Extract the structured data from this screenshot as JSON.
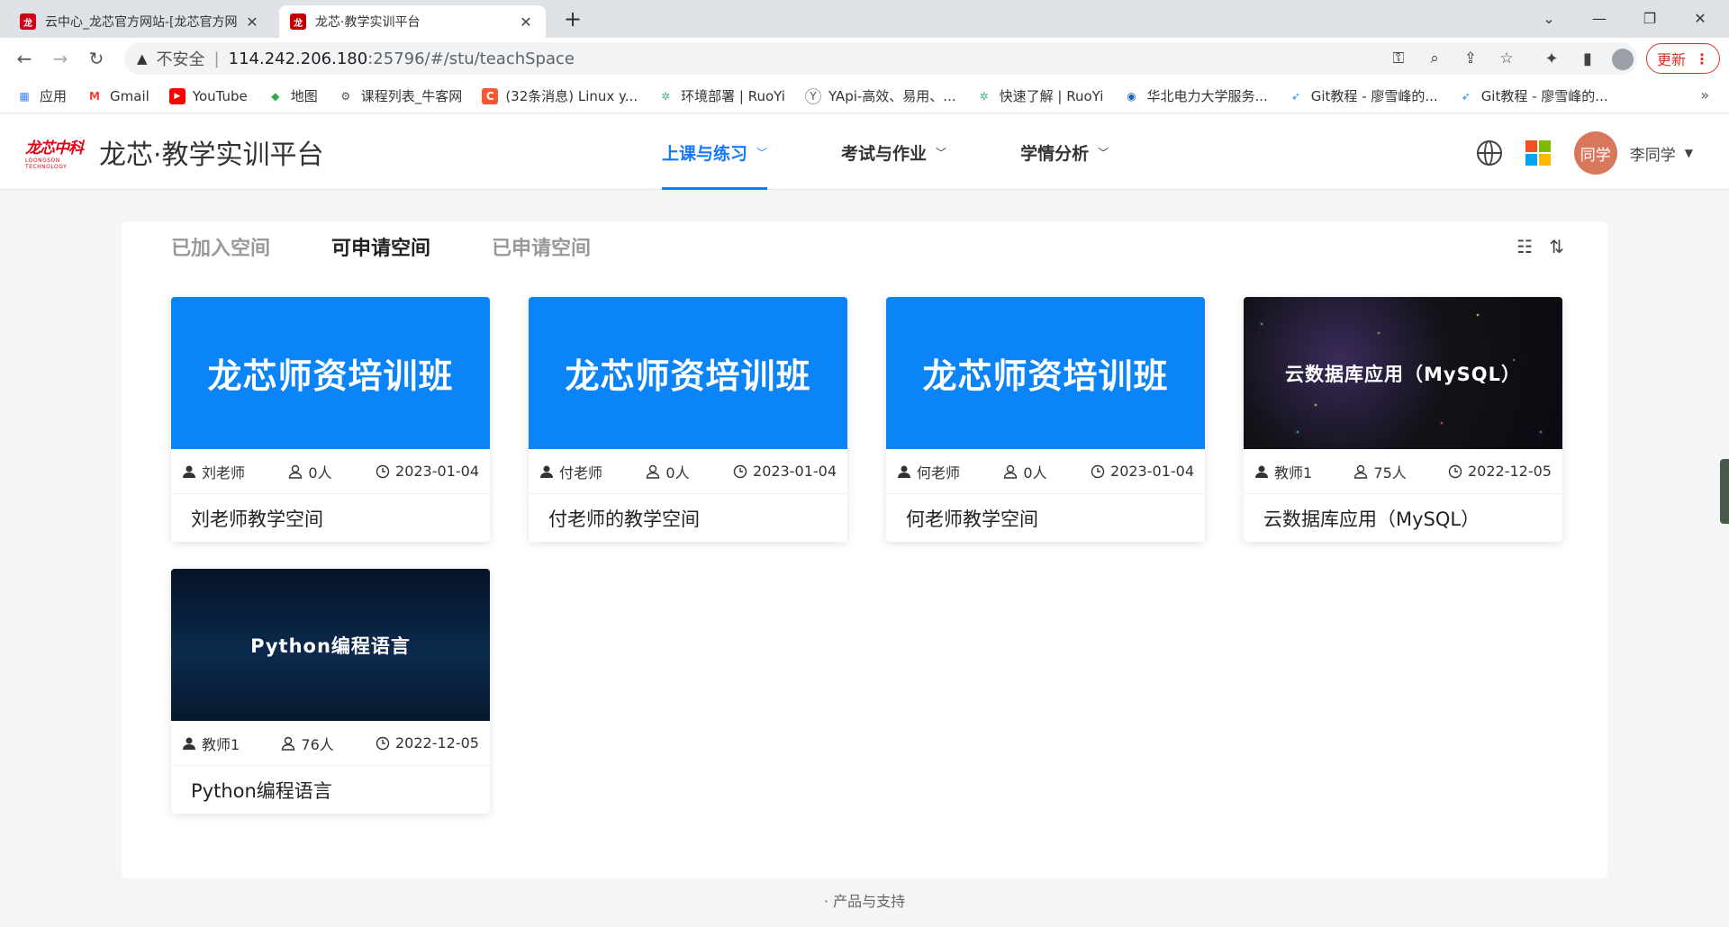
{
  "browser": {
    "tabs": [
      {
        "title": "云中心_龙芯官方网站-[龙芯官方网",
        "favicon_text": "龙",
        "favicon_color": "#d0021b"
      },
      {
        "title": "龙芯·教学实训平台",
        "favicon_text": "龙",
        "favicon_color": "#c00000"
      }
    ],
    "address": {
      "insecure_label": "不安全",
      "host": "114.242.206.180",
      "path": ":25796/#/stu/teachSpace"
    },
    "update_label": "更新",
    "bookmarks": [
      {
        "label": "应用",
        "icon": "apps-grid-icon"
      },
      {
        "label": "Gmail",
        "icon": "gmail-icon"
      },
      {
        "label": "YouTube",
        "icon": "youtube-icon"
      },
      {
        "label": "地图",
        "icon": "maps-icon"
      },
      {
        "label": "课程列表_牛客网",
        "icon": "nowcoder-icon"
      },
      {
        "label": "(32条消息) Linux y...",
        "icon": "csdn-icon"
      },
      {
        "label": "环境部署 | RuoYi",
        "icon": "ruoyi-icon"
      },
      {
        "label": "YApi-高效、易用、...",
        "icon": "yapi-icon"
      },
      {
        "label": "快速了解 | RuoYi",
        "icon": "ruoyi-icon"
      },
      {
        "label": "华北电力大学服务...",
        "icon": "ncepu-icon"
      },
      {
        "label": "Git教程 - 廖雪峰的...",
        "icon": "rocket-icon"
      },
      {
        "label": "Git教程 - 廖雪峰的...",
        "icon": "rocket-icon"
      }
    ]
  },
  "header": {
    "brand_logo_cn": "龙芯中科",
    "brand_logo_en": "LOONGSON TECHNOLOGY",
    "title": "龙芯·教学实训平台",
    "nav": [
      {
        "label": "上课与练习",
        "active": true
      },
      {
        "label": "考试与作业",
        "active": false
      },
      {
        "label": "学情分析",
        "active": false
      }
    ],
    "avatar_text": "同学",
    "user_name": "李同学"
  },
  "space_tabs": [
    {
      "label": "已加入空间",
      "active": false
    },
    {
      "label": "可申请空间",
      "active": true
    },
    {
      "label": "已申请空间",
      "active": false
    }
  ],
  "courses": [
    {
      "cover_text": "龙芯师资培训班",
      "cover_style": "blue",
      "teacher": "刘老师",
      "members": "0人",
      "date": "2023-01-04",
      "title": "刘老师教学空间"
    },
    {
      "cover_text": "龙芯师资培训班",
      "cover_style": "blue",
      "teacher": "付老师",
      "members": "0人",
      "date": "2023-01-04",
      "title": "付老师的教学空间"
    },
    {
      "cover_text": "龙芯师资培训班",
      "cover_style": "blue",
      "teacher": "何老师",
      "members": "0人",
      "date": "2023-01-04",
      "title": "何老师教学空间"
    },
    {
      "cover_text": "云数据库应用（MySQL）",
      "cover_style": "dark",
      "teacher": "教师1",
      "members": "75人",
      "date": "2022-12-05",
      "title": "云数据库应用（MySQL）"
    },
    {
      "cover_text": "Python编程语言",
      "cover_style": "navy",
      "teacher": "教师1",
      "members": "76人",
      "date": "2022-12-05",
      "title": "Python编程语言"
    }
  ],
  "footer": {
    "text": "· 产品与支持"
  },
  "colors": {
    "accent": "#1677ff",
    "avatar": "#d9775c",
    "cover_blue": "#0a84f7",
    "update": "#d93025"
  }
}
